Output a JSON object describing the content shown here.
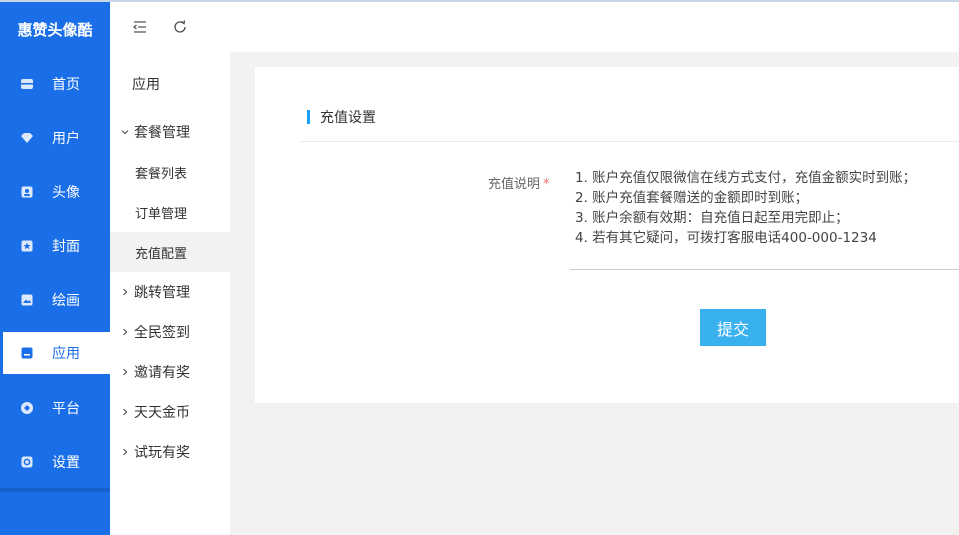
{
  "app": {
    "title": "惠赞头像酷"
  },
  "nav": {
    "items": [
      {
        "label": "首页",
        "icon": "home-icon"
      },
      {
        "label": "用户",
        "icon": "diamond-icon"
      },
      {
        "label": "头像",
        "icon": "avatar-icon"
      },
      {
        "label": "封面",
        "icon": "star-icon"
      },
      {
        "label": "绘画",
        "icon": "picture-icon"
      },
      {
        "label": "应用",
        "icon": "app-icon",
        "active": true
      },
      {
        "label": "平台",
        "icon": "platform-icon"
      },
      {
        "label": "设置",
        "icon": "settings-icon"
      }
    ]
  },
  "subnav": {
    "title": "应用",
    "groups": [
      {
        "label": "套餐管理",
        "expanded": true,
        "children": [
          "套餐列表",
          "订单管理",
          "充值配置"
        ]
      },
      {
        "label": "跳转管理"
      },
      {
        "label": "全民签到"
      },
      {
        "label": "邀请有奖"
      },
      {
        "label": "天天金币"
      },
      {
        "label": "试玩有奖"
      }
    ],
    "active_child": "充值配置"
  },
  "content": {
    "section_title": "充值设置",
    "field_label": "充值说明",
    "required_mark": "*",
    "description_lines": [
      "1. 账户充值仅限微信在线方式支付，充值金额实时到账；",
      "2. 账户充值套餐赠送的金额即时到账；",
      "3. 账户余额有效期：自充值日起至用完即止；",
      "4. 若有其它疑问，可拨打客服电话400-000-1234"
    ],
    "submit_label": "提交"
  },
  "colors": {
    "primary": "#1a6fe8",
    "accent_bar": "#1a9fff",
    "submit": "#3ab1ef",
    "required": "#f56c6c"
  }
}
